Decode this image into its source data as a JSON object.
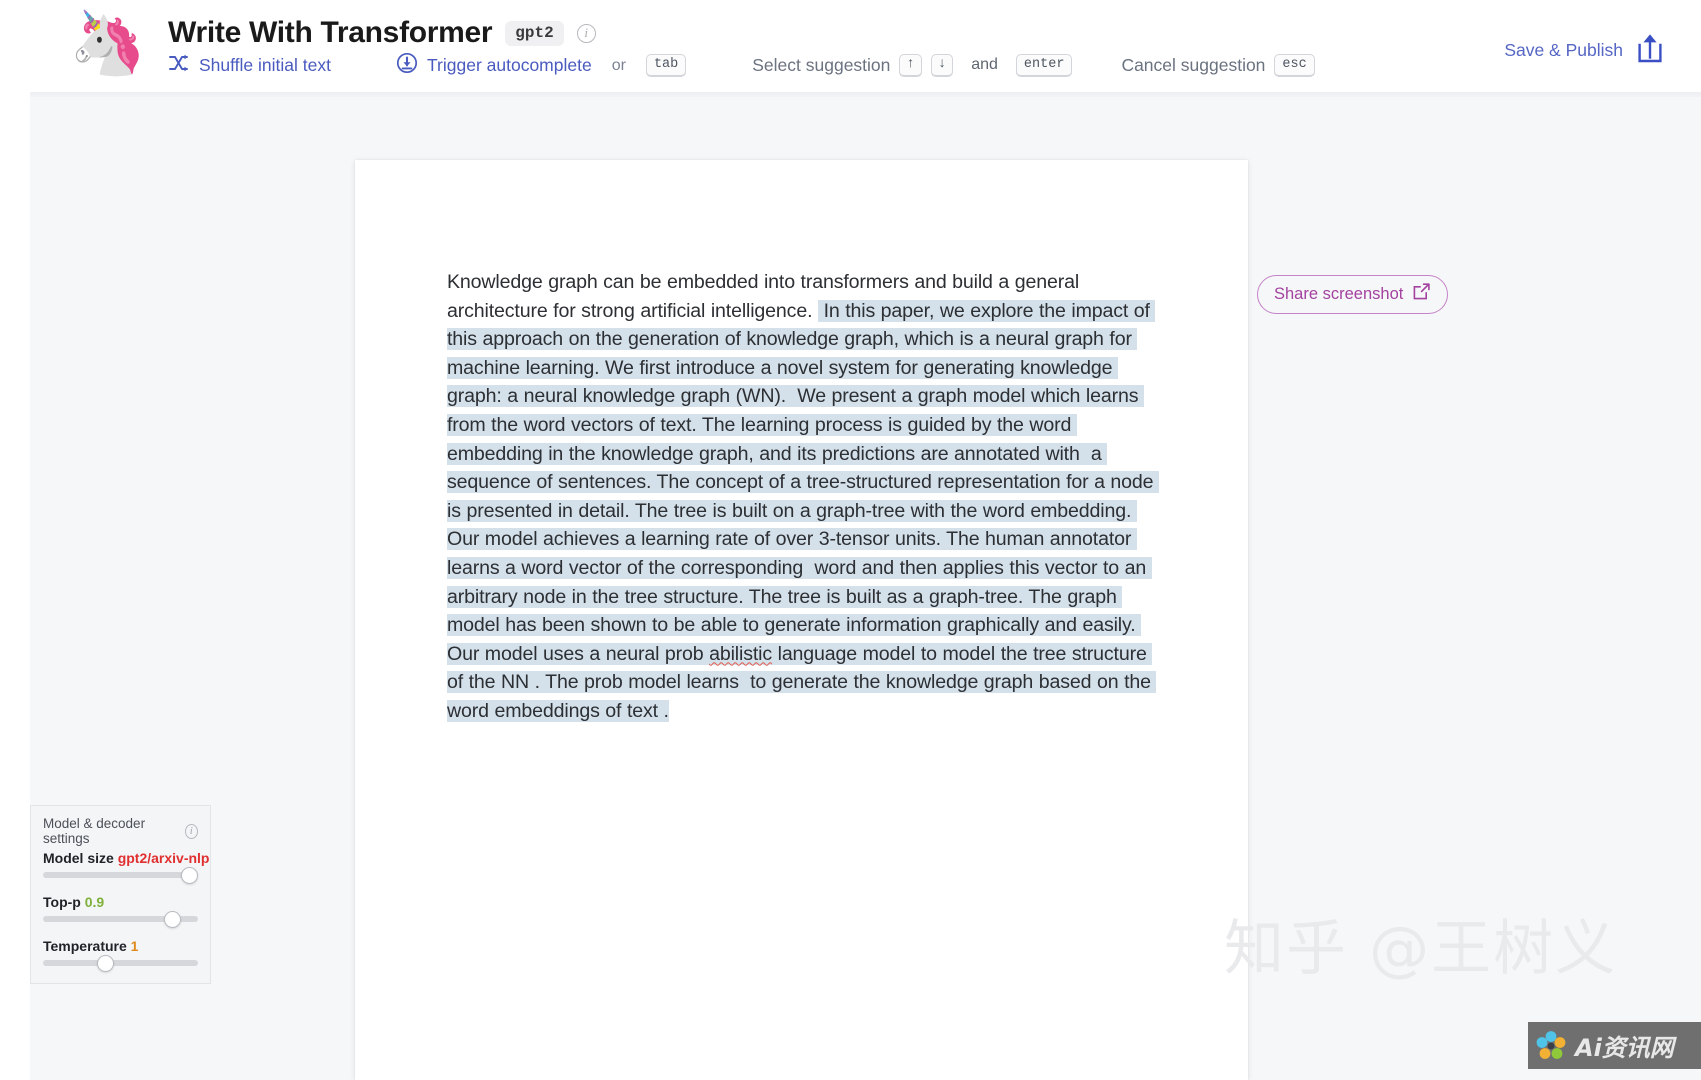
{
  "header": {
    "logo_icon": "unicorn-emoji",
    "logo_glyph": "🦄",
    "title": "Write With Transformer",
    "model_badge": "gpt2",
    "info_icon": "info-icon",
    "info_glyph": "i",
    "hints": [
      {
        "icon": "shuffle-icon",
        "label": "Shuffle initial text"
      },
      {
        "icon": "download-circle-icon",
        "label": "Trigger autocomplete"
      }
    ],
    "or_word": "or",
    "tab_key": "tab",
    "select_suggestion_label": "Select suggestion",
    "arrow_up_key": "↑",
    "arrow_down_key": "↓",
    "and_word": "and",
    "enter_key": "enter",
    "cancel_suggestion_label": "Cancel suggestion",
    "esc_key": "esc",
    "save_publish_label": "Save & Publish",
    "save_publish_icon": "share-upload-icon"
  },
  "share": {
    "label": "Share screenshot",
    "icon": "external-link-icon",
    "border_color": "#c583c8",
    "text_color": "#a3439f"
  },
  "editor": {
    "prompt_text": "Knowledge graph can be embedded into transformers and build a general architecture for strong artificial intelligence. ",
    "generated_segments": [
      " In this paper, we explore the impact of this approach on the generation of knowledge graph, which is a neural graph for machine learning. We first introduce a novel system for generating knowledge graph: a neural knowledge graph (WN).  We present a graph model which learns from the word vectors of text. The learning process is guided by the word embedding in the knowledge graph, and its predictions are annotated with  a sequence of sentences. The concept of a tree-structured representation for a node is presented in detail. The tree is built on a graph-tree with the word embedding. Our model achieves a learning rate of over 3-tensor units. The human annotator learns a word vector of the corresponding  word and then applies this vector to an arbitrary node in the tree structure. The tree is built as a graph-tree. The graph model has been shown to be able to generate information graphically and easily. Our model uses a neural prob ",
      "abilistic",
      " language model to model the tree structure of the NN . The prob model learns  to generate the knowledge graph based on the word embeddings of text ."
    ],
    "misspelled_word": "abilistic",
    "highlight_color": "#d5e1ea"
  },
  "settings": {
    "panel_title": "Model & decoder settings",
    "info_icon": "info-icon",
    "info_glyph": "i",
    "controls": [
      {
        "name": "Model size",
        "value": "gpt2/arxiv-nlp",
        "value_color": "#e03030",
        "position_pct": 92
      },
      {
        "name": "Top-p",
        "value": "0.9",
        "value_color": "#7eb03a",
        "position_pct": 81
      },
      {
        "name": "Temperature",
        "value": "1",
        "value_color": "#e08a1e",
        "position_pct": 38
      }
    ]
  },
  "watermark": {
    "zhihu_text": "知乎 @王树义",
    "badge_text": "Ai资讯网",
    "badge_icon": "flower-logo-icon"
  }
}
